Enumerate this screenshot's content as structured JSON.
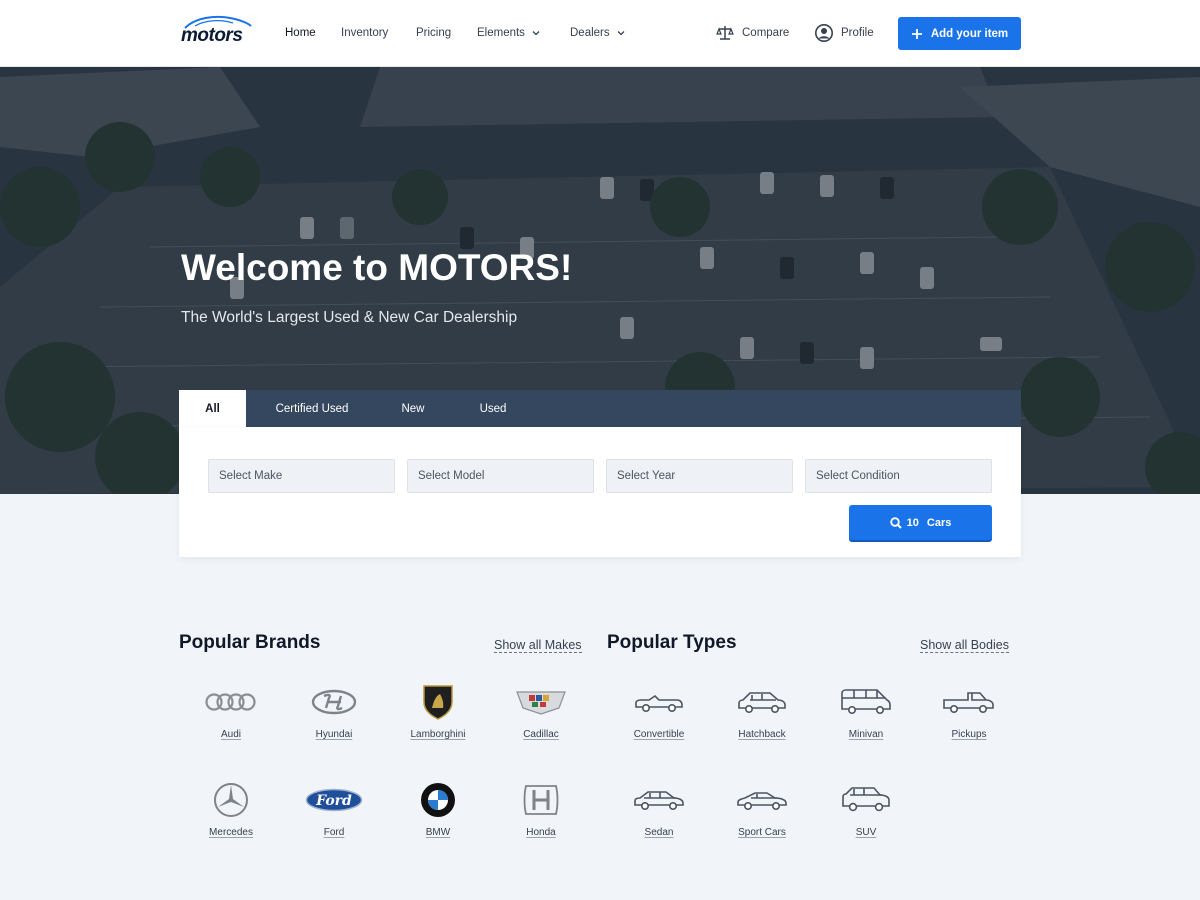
{
  "header": {
    "logo_text": "motors",
    "nav": [
      {
        "label": "Home"
      },
      {
        "label": "Inventory"
      },
      {
        "label": "Pricing"
      },
      {
        "label": "Elements"
      },
      {
        "label": "Dealers"
      }
    ],
    "compare_label": "Compare",
    "profile_label": "Profile",
    "add_item_label": "Add your item"
  },
  "hero": {
    "title": "Welcome to MOTORS!",
    "subtitle": "The World's Largest Used & New Car Dealership"
  },
  "search": {
    "tabs": [
      {
        "label": "All"
      },
      {
        "label": "Certified Used"
      },
      {
        "label": "New"
      },
      {
        "label": "Used"
      }
    ],
    "selects": [
      {
        "label": "Select Make"
      },
      {
        "label": "Select Model"
      },
      {
        "label": "Select Year"
      },
      {
        "label": "Select Condition"
      }
    ],
    "button_count": "10",
    "button_label": "Cars"
  },
  "brands": {
    "title": "Popular Brands",
    "show_all": "Show all Makes",
    "items": [
      {
        "label": "Audi",
        "icon": "audi-logo-icon"
      },
      {
        "label": "Hyundai",
        "icon": "hyundai-logo-icon"
      },
      {
        "label": "Lamborghini",
        "icon": "lamborghini-logo-icon"
      },
      {
        "label": "Cadillac",
        "icon": "cadillac-logo-icon"
      },
      {
        "label": "Mercedes",
        "icon": "mercedes-logo-icon"
      },
      {
        "label": "Ford",
        "icon": "ford-logo-icon"
      },
      {
        "label": "BMW",
        "icon": "bmw-logo-icon"
      },
      {
        "label": "Honda",
        "icon": "honda-logo-icon"
      }
    ]
  },
  "types": {
    "title": "Popular Types",
    "show_all": "Show all Bodies",
    "items": [
      {
        "label": "Convertible",
        "icon": "convertible-icon"
      },
      {
        "label": "Hatchback",
        "icon": "hatchback-icon"
      },
      {
        "label": "Minivan",
        "icon": "minivan-icon"
      },
      {
        "label": "Pickups",
        "icon": "pickup-icon"
      },
      {
        "label": "Sedan",
        "icon": "sedan-icon"
      },
      {
        "label": "Sport Cars",
        "icon": "sport-car-icon"
      },
      {
        "label": "SUV",
        "icon": "suv-icon"
      }
    ]
  },
  "colors": {
    "accent": "#1a73e8",
    "tab_bar": "#34475e",
    "page_bg": "#f1f5f9"
  }
}
